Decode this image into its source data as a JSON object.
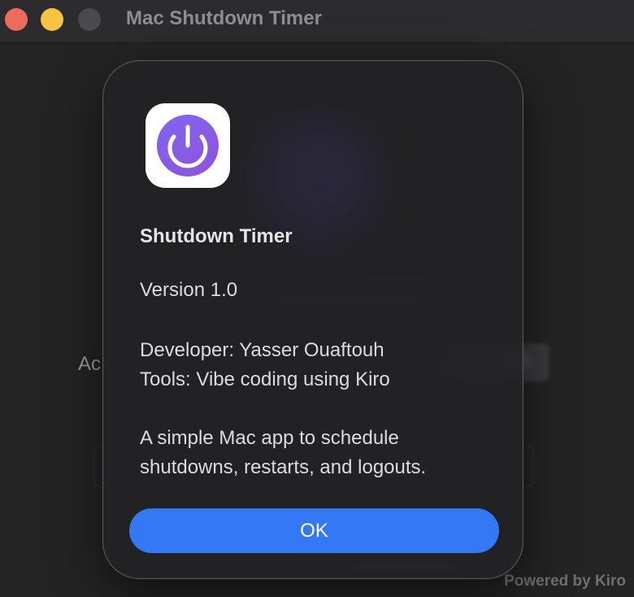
{
  "window": {
    "title": "Mac Shutdown Timer",
    "traffic_lights": {
      "close_color": "#ee6a5f",
      "minimize_color": "#f5c443",
      "zoom_color": "#4a4a4c"
    }
  },
  "background": {
    "action_label_partial": "Ac",
    "footer": "Powered by Kiro"
  },
  "dialog": {
    "icon": "power-icon",
    "icon_gradient": [
      "#8066f2",
      "#9052d8"
    ],
    "title": "Shutdown Timer",
    "version": "Version 1.0",
    "developer": "Developer: Yasser Ouaftouh",
    "tools": "Tools: Vibe coding using Kiro",
    "description_line1": "A simple Mac app to schedule",
    "description_line2": "shutdowns, restarts, and logouts.",
    "ok_label": "OK",
    "ok_color": "#3478f6"
  }
}
